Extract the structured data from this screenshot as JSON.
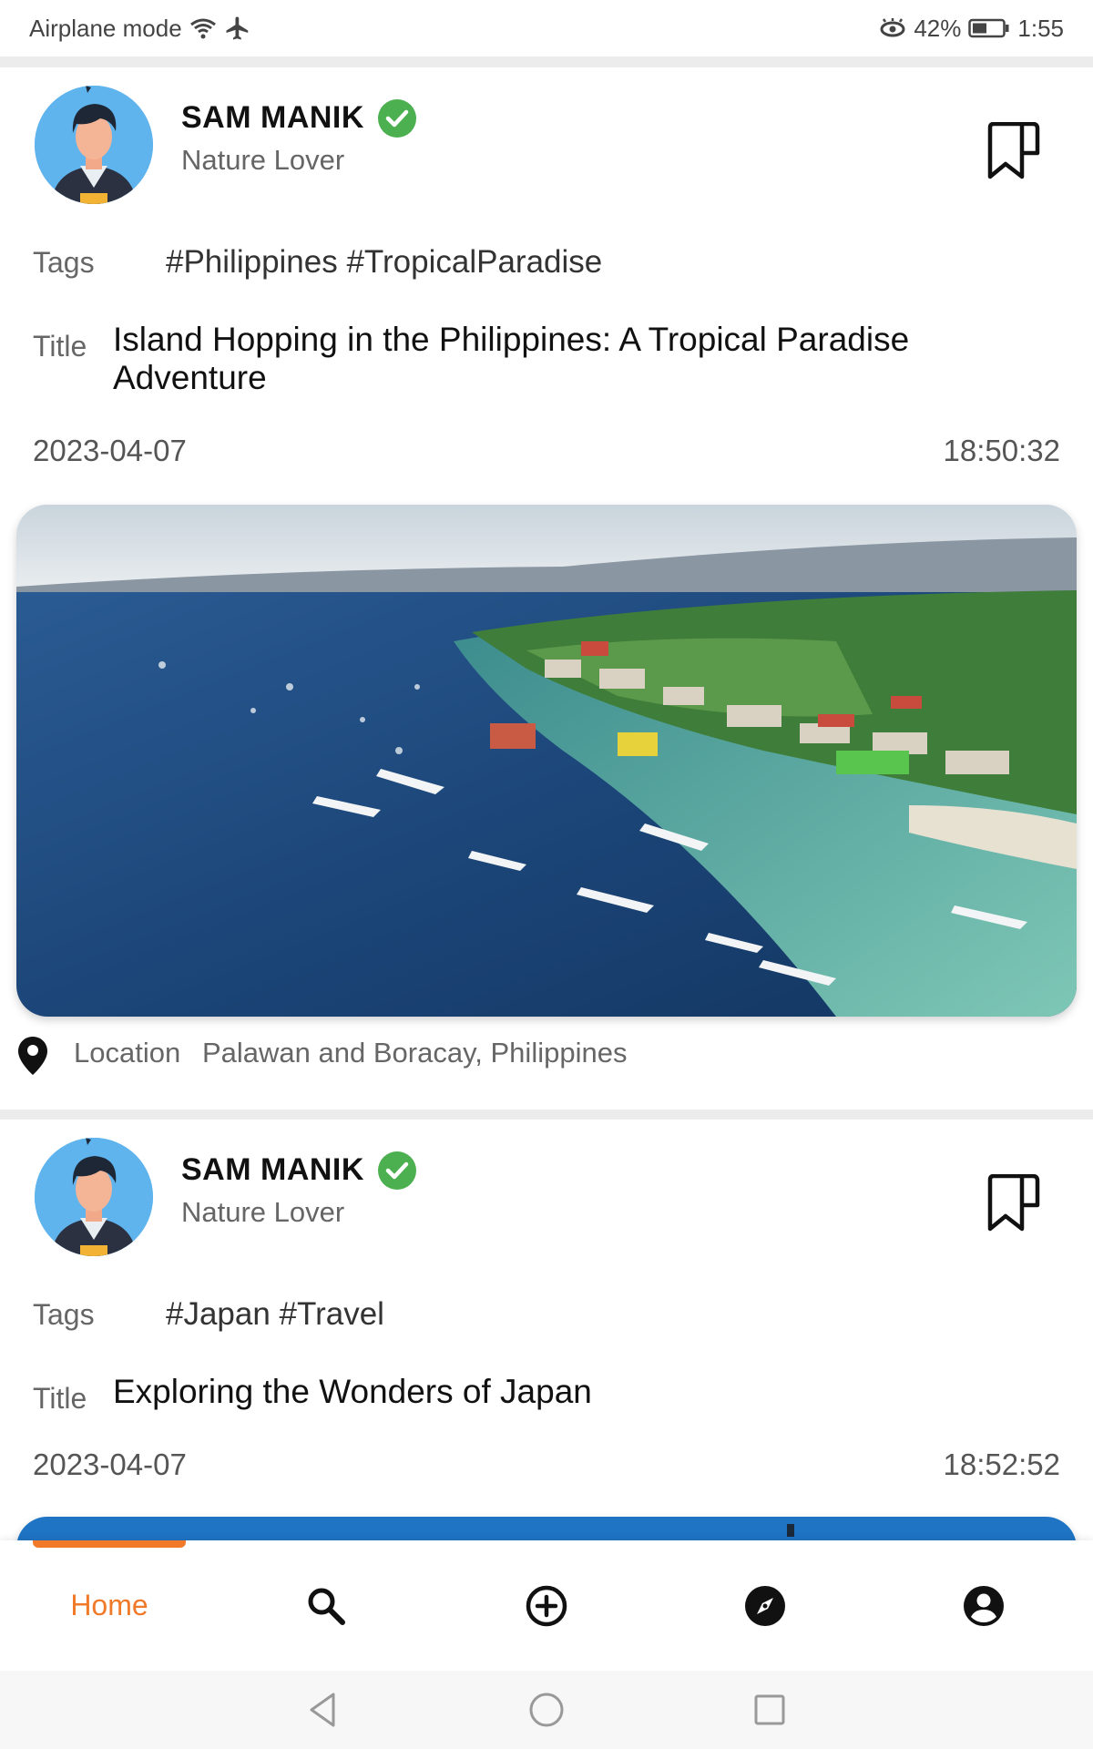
{
  "status_bar": {
    "mode_label": "Airplane mode",
    "battery": "42%",
    "time": "1:55"
  },
  "posts": [
    {
      "author": "SAM MANIK",
      "role": "Nature Lover",
      "tags_label": "Tags",
      "tags": "#Philippines #TropicalParadise",
      "title_label": "Title",
      "title": "Island Hopping in the Philippines: A Tropical Paradise Adventure",
      "date": "2023-04-07",
      "time": "18:50:32",
      "location_label": "Location",
      "location": "Palawan and Boracay, Philippines"
    },
    {
      "author": "SAM MANIK",
      "role": "Nature Lover",
      "tags_label": "Tags",
      "tags": "#Japan #Travel",
      "title_label": "Title",
      "title": "Exploring the Wonders of Japan",
      "date": "2023-04-07",
      "time": "18:52:52"
    }
  ],
  "bottom_nav": {
    "home_label": "Home",
    "items": [
      "search-icon",
      "add-circle-icon",
      "compass-icon",
      "account-icon"
    ],
    "active_color": "#f07a2a"
  },
  "colors": {
    "accent": "#f07a2a",
    "verified": "#4caf50",
    "separator": "#ececec"
  }
}
